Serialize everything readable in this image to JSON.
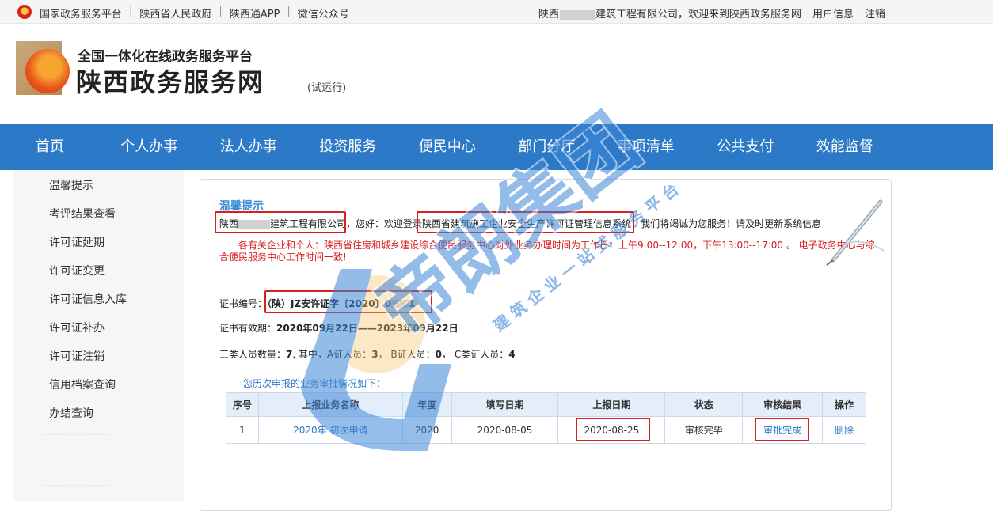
{
  "topbar": {
    "links": [
      "国家政务服务平台",
      "陕西省人民政府",
      "陕西通APP",
      "微信公众号"
    ],
    "welcome_prefix": "陕西",
    "welcome_suffix": "建筑工程有限公司，欢迎来到陕西政务服务网",
    "user_info": "用户信息",
    "logout": "注销"
  },
  "header": {
    "subtitle": "全国一体化在线政务服务平台",
    "title": "陕西政务服务网",
    "trial": "(试运行)"
  },
  "nav": {
    "items": [
      "首页",
      "个人办事",
      "法人办事",
      "投资服务",
      "便民中心",
      "部门分厅",
      "事项清单",
      "公共支付",
      "效能监督"
    ]
  },
  "sidebar": {
    "items": [
      "温馨提示",
      "考评结果查看",
      "许可证延期",
      "许可证变更",
      "许可证信息入库",
      "许可证补办",
      "许可证注销",
      "信用档案查询",
      "办结查询"
    ]
  },
  "content": {
    "tip_title": "温馨提示",
    "company_prefix": "陕西",
    "company_suffix": "建筑工程有限公司",
    "greeting_mid": "，您好：欢迎登录",
    "system_name": "陕西省建筑施工企业安全生产许可证管理信息系统",
    "greeting_end": "，我们将竭诚为您服务！请及时更新系统信息",
    "notice": "各有关企业和个人：陕西省住房和城乡建设综合便民服务中心对外业务办理时间为工作日：上午9:00--12:00，下午13:00--17:00 。 电子政务中心与综合便民服务中心工作时间一致!",
    "cert_no_label": "证书编号：",
    "cert_no_value_a": "（陕）JZ安许证字〔2020〕0",
    "cert_no_value_b": "1",
    "validity_label": "证书有效期：",
    "validity_value": "2020年09月22日——2023年09月22日",
    "staff_text_1": "三类人员数量：",
    "staff_total": "7",
    "staff_text_2": ", 其中，A证人员：",
    "staff_a": "3",
    "staff_text_3": "， B证人员：",
    "staff_b": "0",
    "staff_text_4": "， C类证人员：",
    "staff_c": "4",
    "history_title": "您历次申报的业务审批情况如下："
  },
  "table": {
    "headers": [
      "序号",
      "上报业务名称",
      "年度",
      "填写日期",
      "上报日期",
      "状态",
      "审核结果",
      "操作"
    ],
    "rows": [
      {
        "index": "1",
        "name": "2020年 初次申请",
        "year": "2020",
        "fill_date": "2020-08-05",
        "submit_date": "2020-08-25",
        "status": "审核完毕",
        "result": "审批完成",
        "action": "删除"
      }
    ]
  },
  "watermark": {
    "brand": "帝朗集团",
    "slogan": "建 筑 企 业 一 站 式 服 务 平 台"
  },
  "colors": {
    "nav_bg": "#2c79c8",
    "highlight_red": "#d81e1e",
    "link_blue": "#2c79c8"
  }
}
